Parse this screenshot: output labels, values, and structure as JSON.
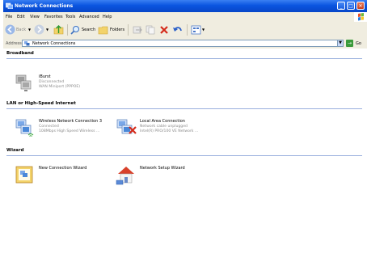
{
  "window": {
    "title": "Network Connections"
  },
  "menu": [
    "File",
    "Edit",
    "View",
    "Favorites",
    "Tools",
    "Advanced",
    "Help"
  ],
  "toolbar": {
    "back_label": "Back",
    "search_label": "Search",
    "folders_label": "Folders"
  },
  "address": {
    "label": "Address",
    "value": "Network Connections",
    "go_label": "Go"
  },
  "groups": [
    {
      "title": "Broadband",
      "items": [
        {
          "name": "iBurst",
          "line1": "Disconnected",
          "line2": "WAN Miniport (PPPOE)"
        }
      ]
    },
    {
      "title": "LAN or High-Speed Internet",
      "items": [
        {
          "name": "Wireless Network Connection 3",
          "line1": "Connected",
          "line2": "108Mbps High Speed Wireless ..."
        },
        {
          "name": "Local Area Connection",
          "line1": "Network cable unplugged",
          "line2": "Intel(R) PRO/100 VE Network ..."
        }
      ]
    },
    {
      "title": "Wizard",
      "items": [
        {
          "name": "New Connection Wizard"
        },
        {
          "name": "Network Setup Wizard"
        }
      ]
    }
  ],
  "colors": {
    "titlebar": "#0a55e0",
    "chrome": "#f0ede0",
    "group_line": "#9ab0de",
    "subtext": "#8c8c8c"
  },
  "icons": [
    "network-connections-icon",
    "broadband-connection-icon",
    "wireless-connection-icon",
    "lan-disconnected-icon",
    "new-connection-wizard-icon",
    "network-setup-wizard-icon"
  ]
}
